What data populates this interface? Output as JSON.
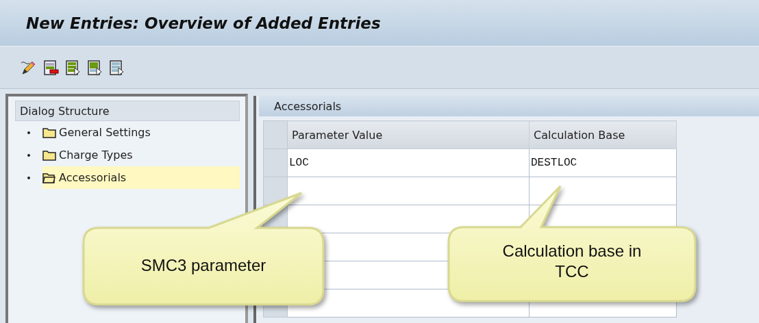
{
  "window": {
    "title": "New Entries: Overview of Added Entries"
  },
  "toolbar": {
    "buttons": [
      {
        "kind": "edit"
      },
      {
        "kind": "delete"
      },
      {
        "kind": "select-all"
      },
      {
        "kind": "select-block"
      },
      {
        "kind": "deselect"
      }
    ]
  },
  "dialog_structure": {
    "title": "Dialog Structure",
    "items": [
      {
        "label": "General Settings",
        "selected": false
      },
      {
        "label": "Charge Types",
        "selected": false
      },
      {
        "label": "Accessorials",
        "selected": true
      }
    ]
  },
  "table": {
    "title": "Accessorials",
    "columns": [
      "Parameter Value",
      "Calculation Base"
    ],
    "rows": [
      {
        "parameter_value": "LOC",
        "calculation_base": "DESTLOC"
      }
    ]
  },
  "callouts": [
    {
      "text": "SMC3 parameter"
    },
    {
      "text": "Calculation base in TCC"
    }
  ]
}
